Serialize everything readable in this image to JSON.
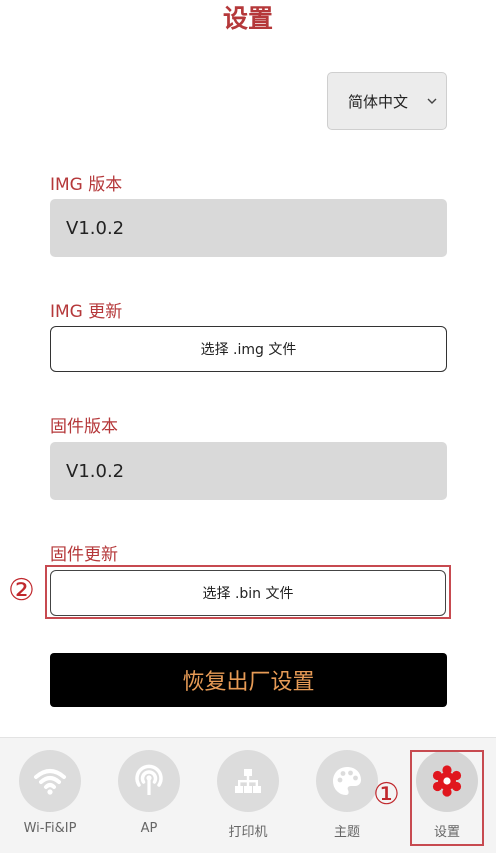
{
  "header": {
    "title": "设置"
  },
  "language": {
    "selected": "简体中文"
  },
  "img_version": {
    "label": "IMG 版本",
    "value": "V1.0.2"
  },
  "img_update": {
    "label": "IMG 更新",
    "button": "选择 .img 文件"
  },
  "fw_version": {
    "label": "固件版本",
    "value": "V1.0.2"
  },
  "fw_update": {
    "label": "固件更新",
    "button": "选择 .bin 文件"
  },
  "reset": {
    "label": "恢复出厂设置"
  },
  "markers": {
    "one": "①",
    "two": "②"
  },
  "tabs": [
    {
      "label": "Wi-Fi&IP",
      "icon": "wifi-icon"
    },
    {
      "label": "AP",
      "icon": "antenna-icon"
    },
    {
      "label": "打印机",
      "icon": "network-icon"
    },
    {
      "label": "主题",
      "icon": "palette-icon"
    },
    {
      "label": "设置",
      "icon": "gear-icon",
      "active": true
    }
  ],
  "colors": {
    "accent": "#b5383a",
    "reset_text": "#e79b56",
    "active_icon": "#e0161e",
    "icon_gray": "#9a9a9a"
  }
}
